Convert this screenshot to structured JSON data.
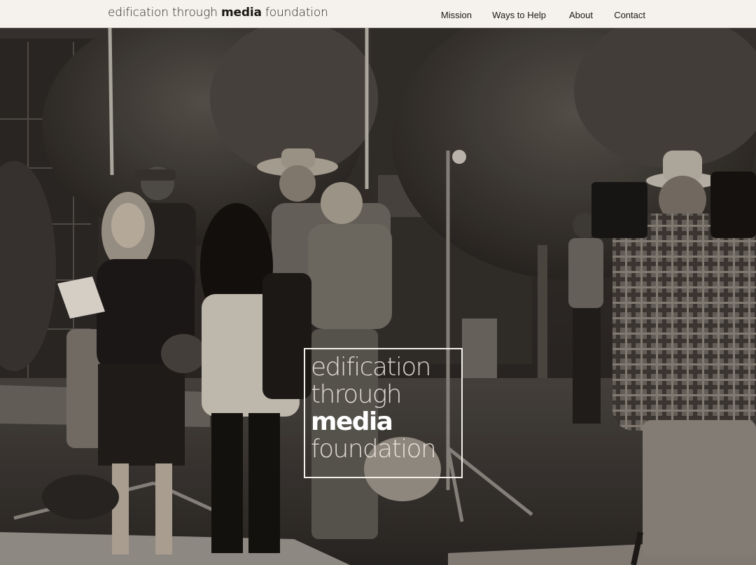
{
  "header": {
    "brand_part1": "edification through ",
    "brand_part2": "media",
    "brand_part3": " foundation"
  },
  "nav": {
    "items": [
      {
        "label": "Mission"
      },
      {
        "label": "Ways to Help"
      },
      {
        "label": "About"
      },
      {
        "label": "Contact"
      }
    ]
  },
  "hero": {
    "logo_lines": [
      "edification",
      "through",
      "media",
      "foundation"
    ]
  }
}
